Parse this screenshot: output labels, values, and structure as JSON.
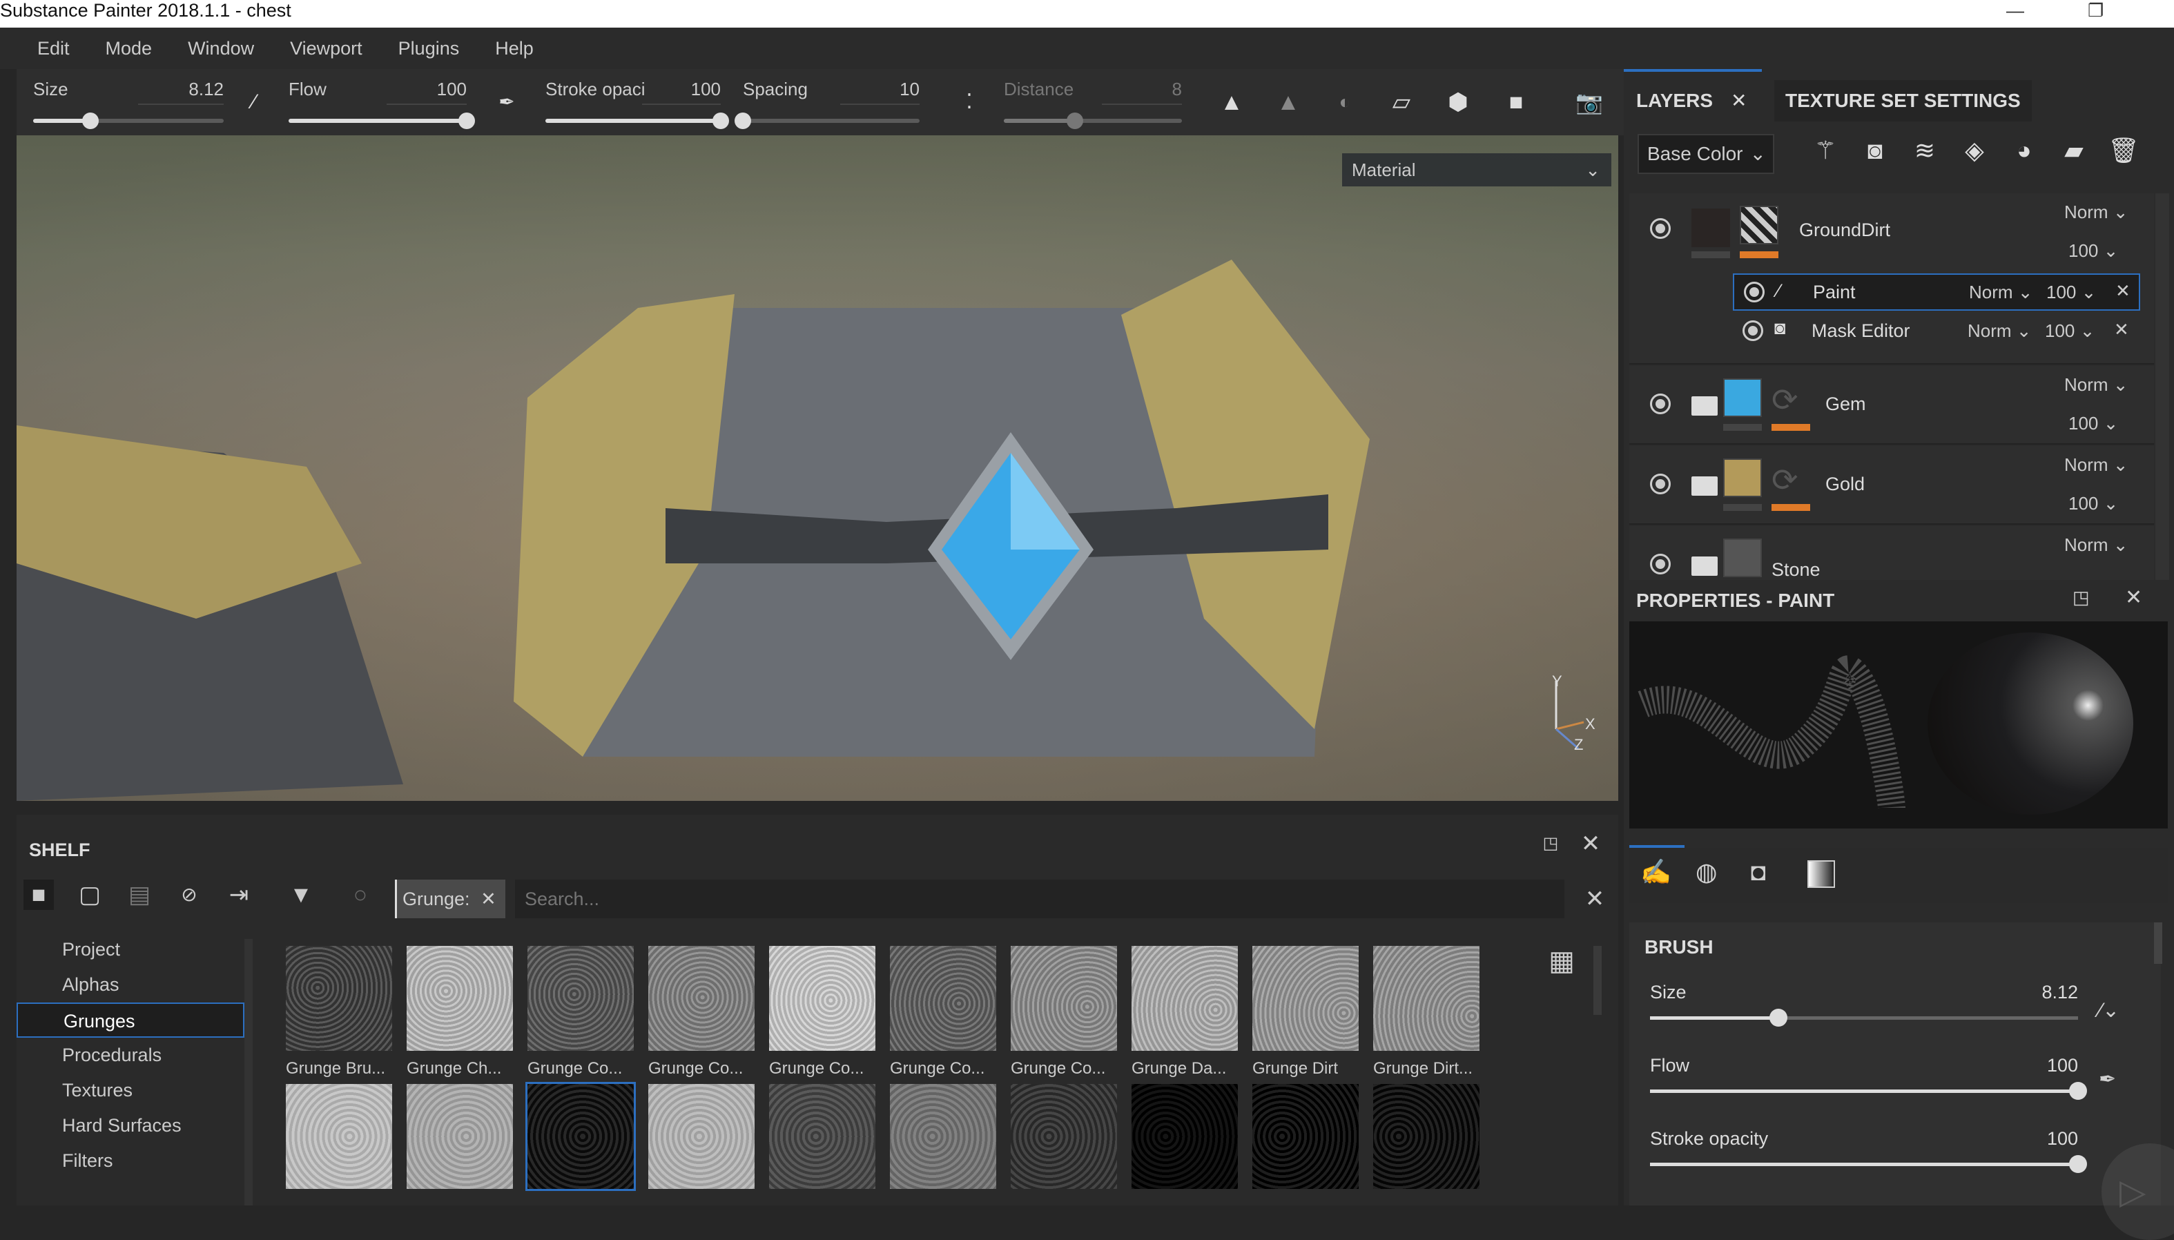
{
  "window": {
    "title": "Substance Painter 2018.1.1 - chest",
    "minimize": "—",
    "restore": "❐"
  },
  "menu": [
    "Edit",
    "Mode",
    "Window",
    "Viewport",
    "Plugins",
    "Help"
  ],
  "toolbar": {
    "size": {
      "label": "Size",
      "value": "8.12",
      "fraction": 0.3
    },
    "flow": {
      "label": "Flow",
      "value": "100",
      "fraction": 1.0
    },
    "stroke_opacity": {
      "label": "Stroke opaci",
      "value": "100",
      "fraction": 1.0
    },
    "spacing": {
      "label": "Spacing",
      "value": "10",
      "fraction": 0.0
    },
    "distance": {
      "label": "Distance",
      "value": "8",
      "fraction": 0.4,
      "enabled": false
    },
    "icons": [
      "symmetry-icon",
      "symmetry-mirror-icon",
      "light-icon",
      "perspective-icon",
      "cube-view-icon",
      "camera-icon",
      "screenshot-icon"
    ]
  },
  "viewport": {
    "channel_select": "Material",
    "axis": {
      "y": "Y",
      "x": "X",
      "z": "Z"
    },
    "gem_color": "#3aa8e8"
  },
  "shelf": {
    "title": "SHELF",
    "filter_tag": "Grunge:",
    "search_placeholder": "Search...",
    "categories": [
      {
        "label": "Project"
      },
      {
        "label": "Alphas"
      },
      {
        "label": "Grunges",
        "selected": true
      },
      {
        "label": "Procedurals"
      },
      {
        "label": "Textures"
      },
      {
        "label": "Hard Surfaces"
      },
      {
        "label": "Filters"
      }
    ],
    "assets": [
      "Grunge Bru...",
      "Grunge Ch...",
      "Grunge Co...",
      "Grunge Co...",
      "Grunge Co...",
      "Grunge Co...",
      "Grunge Co...",
      "Grunge Da...",
      "Grunge Dirt",
      "Grunge Dirt..."
    ]
  },
  "layers_panel": {
    "tabs": [
      "LAYERS",
      "TEXTURE SET SETTINGS"
    ],
    "channel": "Base Color",
    "accent": "#e07a28",
    "selection": "#2c6fc0",
    "layers": [
      {
        "name": "GroundDirt",
        "blend": "Norm",
        "opacity": "100",
        "type": "fill",
        "effects": [
          {
            "name": "Paint",
            "blend": "Norm",
            "opacity": "100",
            "selected": true
          },
          {
            "name": "Mask Editor",
            "blend": "Norm",
            "opacity": "100"
          }
        ]
      },
      {
        "name": "Gem",
        "blend": "Norm",
        "opacity": "100",
        "type": "folder",
        "color": "#3aa8e0"
      },
      {
        "name": "Gold",
        "blend": "Norm",
        "opacity": "100",
        "type": "folder",
        "color": "#b39a5a"
      },
      {
        "name": "Stone",
        "blend": "Norm",
        "type": "folder",
        "color": "#555555"
      }
    ]
  },
  "properties": {
    "title": "PROPERTIES - PAINT",
    "section": "BRUSH",
    "size": {
      "label": "Size",
      "value": "8.12",
      "fraction": 0.3
    },
    "flow": {
      "label": "Flow",
      "value": "100",
      "fraction": 1.0
    },
    "stroke_opacity": {
      "label": "Stroke opacity",
      "value": "100",
      "fraction": 1.0
    }
  }
}
